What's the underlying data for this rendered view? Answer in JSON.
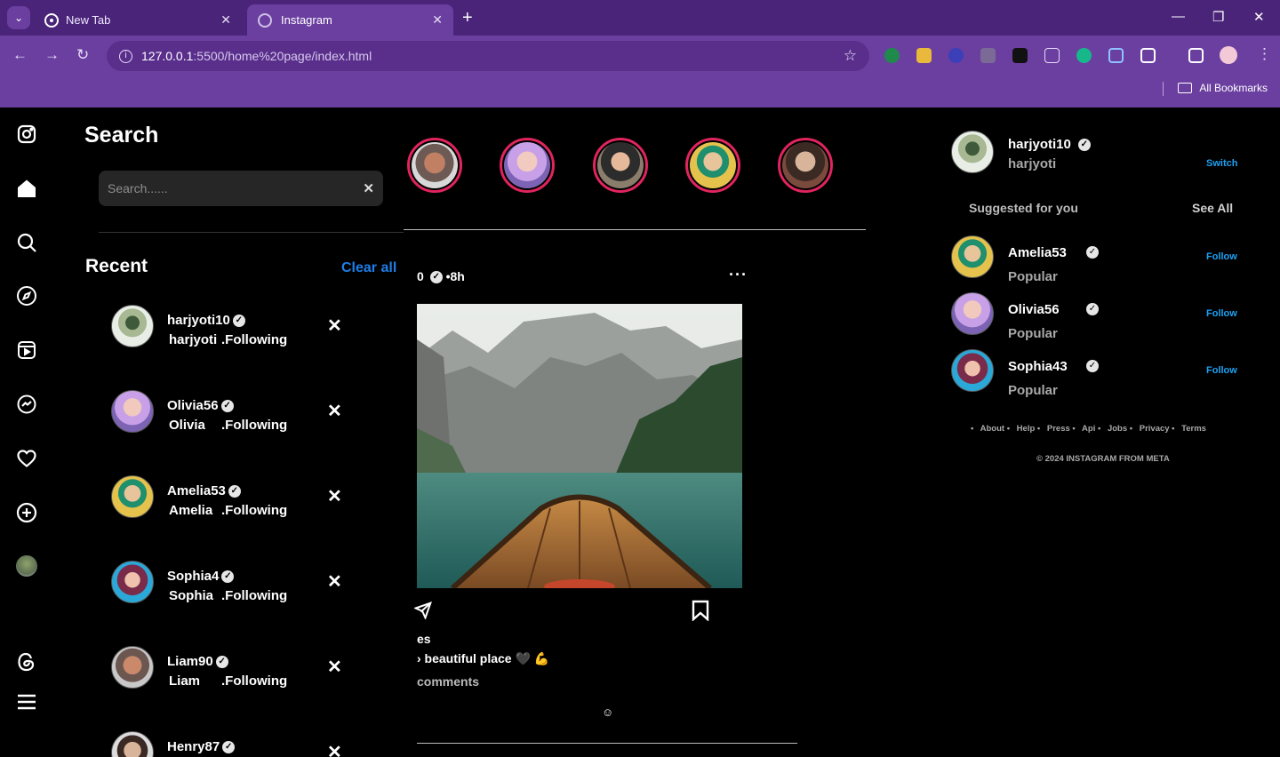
{
  "browser": {
    "tabs": [
      {
        "title": "New Tab"
      },
      {
        "title": "Instagram"
      }
    ],
    "url_host": "127.0.0.1",
    "url_path": ":5500/home%20page/index.html",
    "bookmarks_label": "All Bookmarks"
  },
  "search_panel": {
    "title": "Search",
    "placeholder": "Search......",
    "recent_title": "Recent",
    "clear_all": "Clear all",
    "recent": [
      {
        "username": "harjyoti10",
        "name": "harjyoti",
        "status": ".Following"
      },
      {
        "username": "Olivia56",
        "name": "Olivia",
        "status": ".Following"
      },
      {
        "username": "Amelia53",
        "name": "Amelia",
        "status": ".Following"
      },
      {
        "username": "Sophia4",
        "name": "Sophia",
        "status": ".Following"
      },
      {
        "username": "Liam90",
        "name": "Liam",
        "status": ".Following"
      },
      {
        "username": "Henry87",
        "name": "",
        "status": ""
      }
    ]
  },
  "post": {
    "header": "0",
    "time": "•8h",
    "likes": "es",
    "caption": "› beautiful place 🖤 💪",
    "comments": "comments",
    "emoji": "☺"
  },
  "profile": {
    "username": "harjyoti10",
    "name": "harjyoti",
    "switch": "Switch"
  },
  "suggestions": {
    "title": "Suggested for you",
    "see_all": "See All",
    "items": [
      {
        "username": "Amelia53",
        "sub": "Popular",
        "action": "Follow"
      },
      {
        "username": "Olivia56",
        "sub": "Popular",
        "action": "Follow"
      },
      {
        "username": "Sophia43",
        "sub": "Popular",
        "action": "Follow"
      }
    ]
  },
  "footer": {
    "links": [
      "•",
      "About •",
      "Help •",
      "Press •",
      "Api •",
      "Jobs •",
      "Privacy •",
      "Terms"
    ],
    "copyright": "© 2024 INSTAGRAM FROM META"
  },
  "colors": {
    "browser_frame": "#4a2478",
    "browser_toolbar": "#6b3fa0",
    "story_ring": "#e0245e",
    "link_blue": "#1ea1f2",
    "clear_all_blue": "#1e7ee8"
  }
}
